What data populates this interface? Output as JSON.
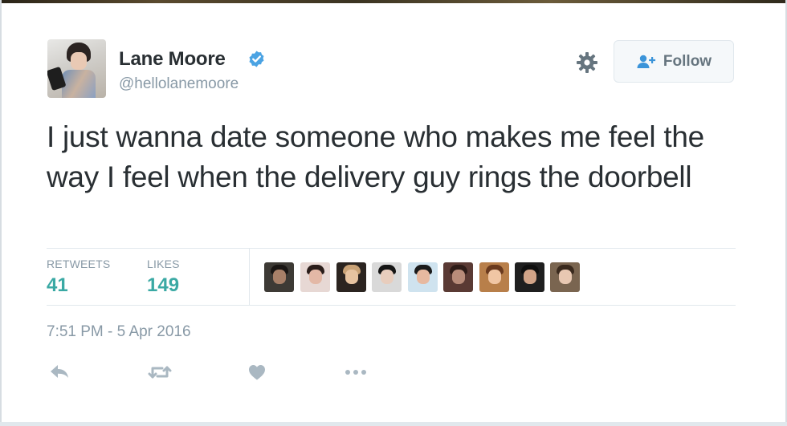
{
  "tweet": {
    "author": {
      "display_name": "Lane Moore",
      "handle": "@hellolanemoore",
      "verified": true
    },
    "follow_button_label": "Follow",
    "text": "I just wanna date someone who makes me feel the way I feel when the delivery guy rings the doorbell",
    "stats": {
      "retweets_label": "RETWEETS",
      "retweets_count": "41",
      "likes_label": "LIKES",
      "likes_count": "149"
    },
    "timestamp": "7:51 PM - 5 Apr 2016",
    "actions": [
      "reply",
      "retweet",
      "like",
      "more"
    ]
  },
  "icons": {
    "verified": "verified-badge-icon",
    "settings": "gear-icon",
    "follow": "add-user-icon",
    "reply": "reply-icon",
    "retweet": "retweet-icon",
    "like": "heart-icon",
    "more": "more-dots-icon"
  },
  "colors": {
    "text": "#292f33",
    "muted": "#8899a6",
    "verified_blue": "#4ba3e3",
    "stat_teal": "#3aa9a4",
    "action_gray": "#aab8c2",
    "border": "#e1e8ed"
  }
}
